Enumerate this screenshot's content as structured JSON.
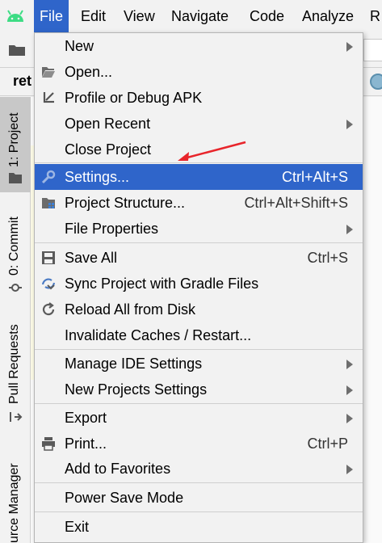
{
  "menubar": {
    "items": [
      {
        "label": "File",
        "active": true
      },
      {
        "label": "Edit"
      },
      {
        "label": "View"
      },
      {
        "label": "Navigate"
      },
      {
        "label": "Code"
      },
      {
        "label": "Analyze"
      },
      {
        "label": "R"
      }
    ]
  },
  "toolbar": {
    "tab_label": "ret"
  },
  "left_strip": {
    "project": "1: Project",
    "commit": "0: Commit",
    "pull_requests": "Pull Requests",
    "resource_manager": "urce Manager"
  },
  "file_menu": {
    "items": [
      {
        "label": "New",
        "submenu": true,
        "icon": "none"
      },
      {
        "label": "Open...",
        "icon": "folder-icon"
      },
      {
        "label": "Profile or Debug APK",
        "icon": "import-arrow-icon"
      },
      {
        "label": "Open Recent",
        "submenu": true
      },
      {
        "label": "Close Project"
      },
      {
        "label": "Settings...",
        "shortcut": "Ctrl+Alt+S",
        "icon": "wrench-icon",
        "selected": true
      },
      {
        "label": "Project Structure...",
        "shortcut": "Ctrl+Alt+Shift+S",
        "icon": "project-structure-icon"
      },
      {
        "label": "File Properties",
        "submenu": true
      },
      {
        "label": "Save All",
        "shortcut": "Ctrl+S",
        "icon": "save-icon"
      },
      {
        "label": "Sync Project with Gradle Files",
        "icon": "gradle-sync-icon"
      },
      {
        "label": "Reload All from Disk",
        "icon": "reload-icon"
      },
      {
        "label": "Invalidate Caches / Restart..."
      },
      {
        "label": "Manage IDE Settings",
        "submenu": true
      },
      {
        "label": "New Projects Settings",
        "submenu": true
      },
      {
        "label": "Export",
        "submenu": true
      },
      {
        "label": "Print...",
        "shortcut": "Ctrl+P",
        "icon": "printer-icon"
      },
      {
        "label": "Add to Favorites",
        "submenu": true
      },
      {
        "label": "Power Save Mode"
      },
      {
        "label": "Exit"
      }
    ]
  },
  "colors": {
    "accent": "#2f65ca",
    "annotation": "#e8252b"
  }
}
